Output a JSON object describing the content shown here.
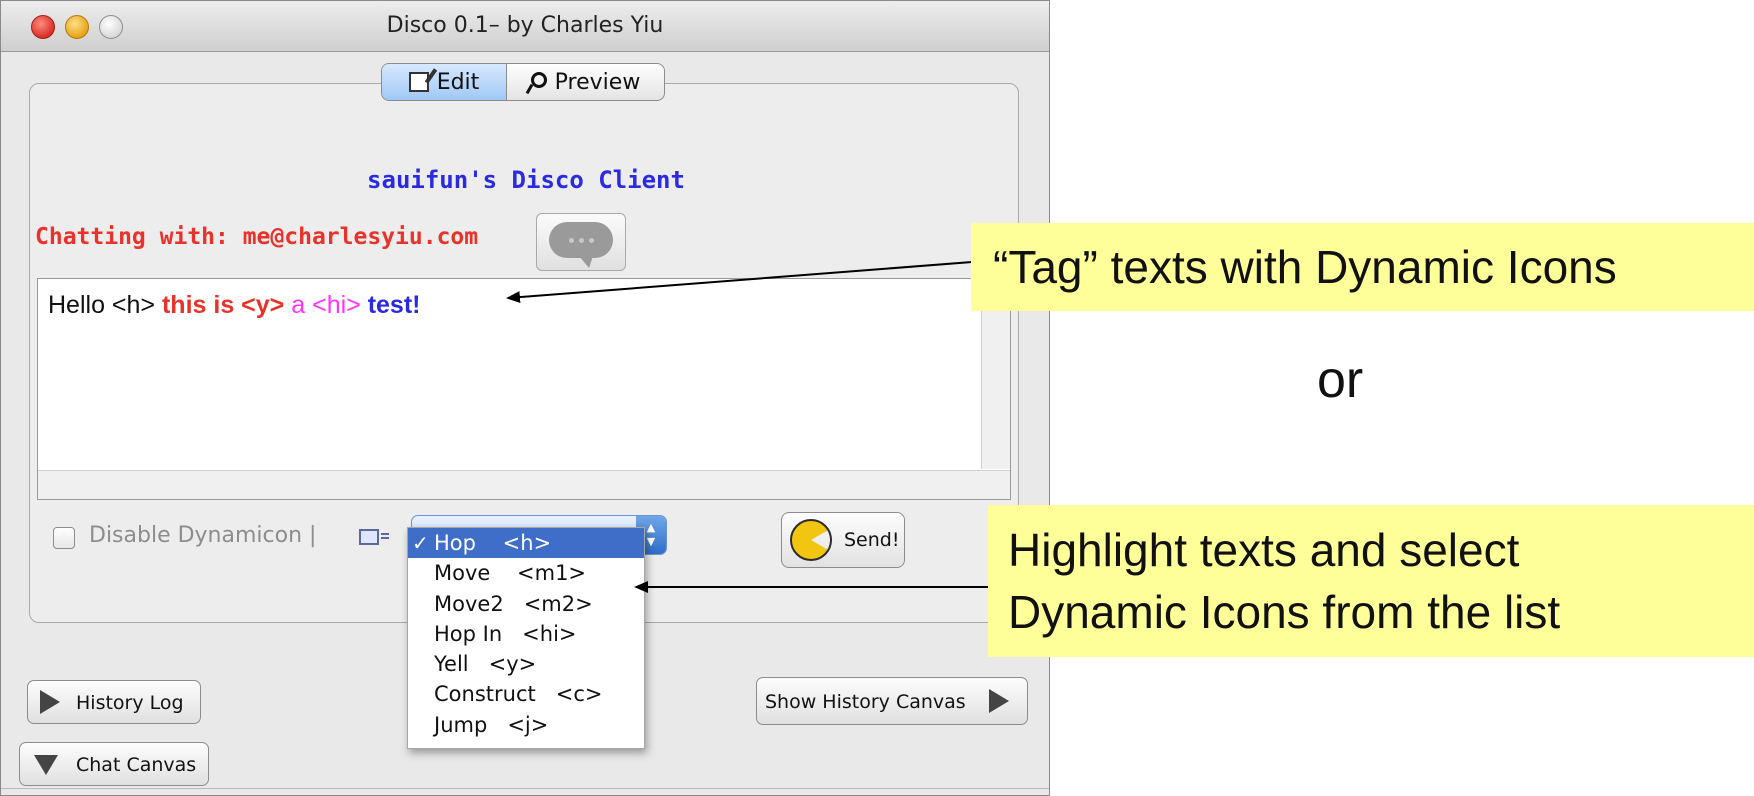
{
  "window": {
    "title": "Disco 0.1– by Charles Yiu",
    "tabs": [
      {
        "label": "Edit",
        "icon": "edit-icon",
        "selected": true
      },
      {
        "label": "Preview",
        "icon": "magnifier-icon",
        "selected": false
      }
    ]
  },
  "client": {
    "title": "sauifun's Disco Client",
    "chatting_with": "Chatting with: me@charlesyiu.com"
  },
  "message": {
    "segments": [
      {
        "text": "Hello ",
        "color": "#111111",
        "bold": false
      },
      {
        "text": "<h> ",
        "color": "#111111",
        "bold": false
      },
      {
        "text": "this is ",
        "color": "#e8322a",
        "bold": true
      },
      {
        "text": "<y> ",
        "color": "#e8322a",
        "bold": true
      },
      {
        "text": "a ",
        "color": "#ff33ff",
        "bold": false
      },
      {
        "text": "<hi> ",
        "color": "#ff33ff",
        "bold": false
      },
      {
        "text": "test!",
        "color": "#2a2adf",
        "bold": true
      }
    ]
  },
  "controls": {
    "disable_label": "Disable Dynamicon |",
    "send_label": "Send!",
    "dropdown_items": [
      {
        "label": "Hop    <h>",
        "selected": true
      },
      {
        "label": "Move    <m1>",
        "selected": false
      },
      {
        "label": "Move2   <m2>",
        "selected": false
      },
      {
        "label": "Hop In   <hi>",
        "selected": false
      },
      {
        "label": "Yell   <y>",
        "selected": false
      },
      {
        "label": "Construct   <c>",
        "selected": false
      },
      {
        "label": "Jump   <j>",
        "selected": false
      }
    ],
    "check_mark": "✓",
    "history_log": "History Log",
    "show_history_canvas": "Show History Canvas",
    "chat_canvas": "Chat Canvas"
  },
  "annotations": {
    "callout1": "“Tag” texts with Dynamic Icons",
    "or": "or",
    "callout2_line1": "Highlight texts and select",
    "callout2_line2": "Dynamic Icons from the list"
  },
  "colors": {
    "client_title": "#2a2adf",
    "chatting": "#e8322a",
    "selection": "#3f6ec8",
    "callout_bg": "#ffff99"
  }
}
